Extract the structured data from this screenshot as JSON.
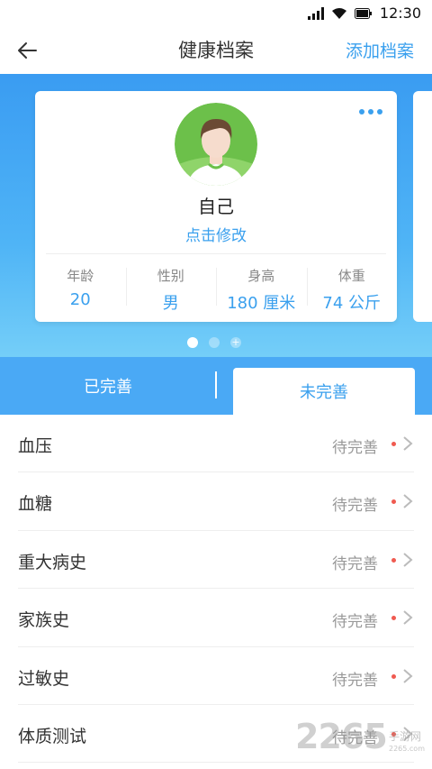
{
  "status_bar": {
    "time": "12:30"
  },
  "header": {
    "title": "健康档案",
    "action_label": "添加档案"
  },
  "profile": {
    "name": "自己",
    "edit_label": "点击修改",
    "stats": [
      {
        "label": "年龄",
        "value": "20"
      },
      {
        "label": "性别",
        "value": "男"
      },
      {
        "label": "身高",
        "value": "180 厘米"
      },
      {
        "label": "体重",
        "value": "74 公斤"
      }
    ]
  },
  "tabs": {
    "done_label": "已完善",
    "todo_label": "未完善",
    "active": "todo"
  },
  "list": [
    {
      "label": "血压",
      "status": "待完善"
    },
    {
      "label": "血糖",
      "status": "待完善"
    },
    {
      "label": "重大病史",
      "status": "待完善"
    },
    {
      "label": "家族史",
      "status": "待完善"
    },
    {
      "label": "过敏史",
      "status": "待完善"
    },
    {
      "label": "体质测试",
      "status": "待完善"
    }
  ],
  "watermark": {
    "text": "2265",
    "sub": "手游网",
    "url": "2265.com"
  },
  "colors": {
    "accent": "#3aa0ee",
    "banner": "#4aa9f5",
    "status_dot": "#f05a50"
  }
}
